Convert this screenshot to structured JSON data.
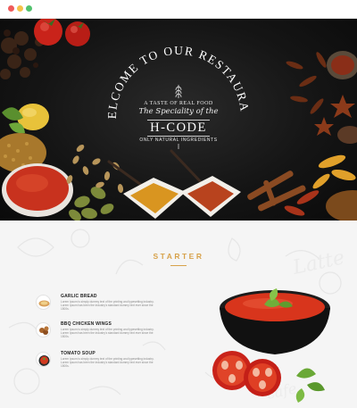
{
  "browser": {
    "controls": [
      "close",
      "minimize",
      "maximize"
    ]
  },
  "hero": {
    "arc_text": "WELCOME TO OUR RESTAURANT",
    "tagline": "A TASTE OF REAL FOOD",
    "speciality": "The Speciality of the",
    "brand": "H-CODE",
    "subline": "ONLY NATURAL INGREDIENTS",
    "icon": "wheat-icon"
  },
  "starter": {
    "title": "STARTER",
    "items": [
      {
        "name": "GARLIC BREAD",
        "description": "Lorem Ipsum is simply dummy text of the printing and typesetting industry. Lorem Ipsum has been the industry's standard dummy text ever since the 1500s.",
        "icon": "garlic-bread-thumb"
      },
      {
        "name": "BBQ CHICKEN WINGS",
        "description": "Lorem Ipsum is simply dummy text of the printing and typesetting industry. Lorem Ipsum has been the industry's standard dummy text ever since the 1500s.",
        "icon": "chicken-wings-thumb"
      },
      {
        "name": "TOMATO SOUP",
        "description": "Lorem Ipsum is simply dummy text of the printing and typesetting industry. Lorem Ipsum has been the industry's standard dummy text ever since the 1500s.",
        "icon": "tomato-soup-thumb"
      }
    ]
  },
  "colors": {
    "accent": "#d7a24b",
    "hero_bg": "#111111",
    "section_bg": "#f5f5f5"
  }
}
